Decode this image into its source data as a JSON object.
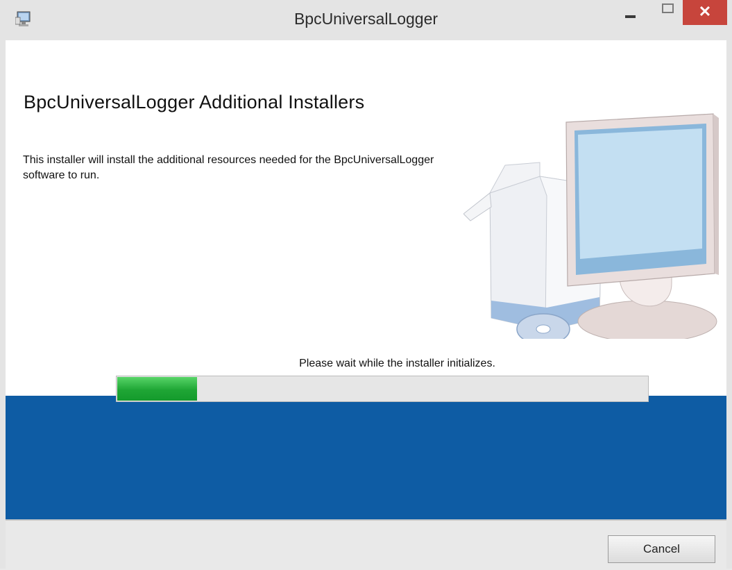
{
  "window": {
    "title": "BpcUniversalLogger",
    "close_glyph": "✕"
  },
  "main": {
    "heading": "BpcUniversalLogger Additional Installers",
    "description": "This installer will install the additional resources needed for the BpcUniversalLogger software to run.",
    "status_text": "Please wait while the installer initializes.",
    "progress": 0.15
  },
  "footer": {
    "cancel_label": "Cancel"
  },
  "colors": {
    "banner_blue": "#0e5ca4",
    "progress_green": "#1fa635",
    "close_red": "#c7453c"
  },
  "icons": {
    "app_icon": "installer-computer-icon",
    "illustration": "computer-install-illustration"
  }
}
